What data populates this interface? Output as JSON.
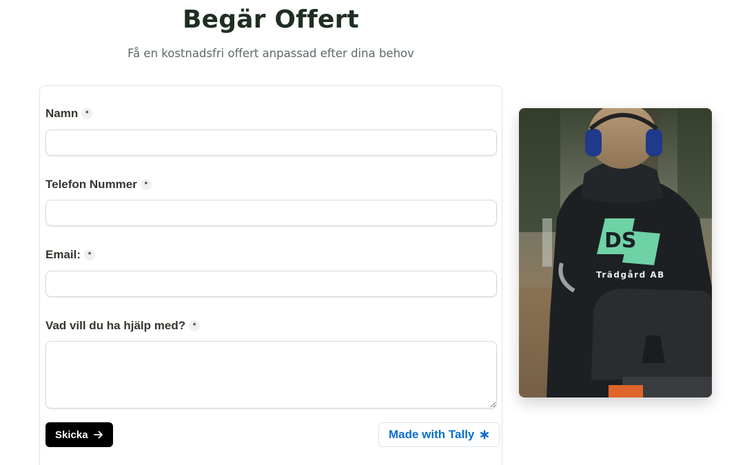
{
  "header": {
    "title": "Begär Offert",
    "subtitle": "Få en kostnadsfri offert anpassad efter dina behov"
  },
  "form": {
    "fields": [
      {
        "label": "Namn",
        "required_mark": "*",
        "value": "",
        "placeholder": ""
      },
      {
        "label": "Telefon Nummer",
        "required_mark": "*",
        "value": "",
        "placeholder": ""
      },
      {
        "label": "Email:",
        "required_mark": "*",
        "value": "",
        "placeholder": ""
      },
      {
        "label": "Vad vill du ha hjälp med?",
        "required_mark": "*",
        "value": "",
        "placeholder": ""
      }
    ],
    "submit_label": "Skicka",
    "submit_icon": "arrow-right-icon",
    "badge_label": "Made with Tally",
    "badge_icon": "asterisk-icon"
  },
  "photo": {
    "description_icon": "worker-photo",
    "logo_text": "DS",
    "logo_subtext": "Trädgård AB"
  },
  "colors": {
    "title": "#1f2e22",
    "subtitle": "#5d6a62",
    "submit_bg": "#000000",
    "badge_text": "#0a6dd1",
    "logo_green": "#6fd1a6"
  }
}
